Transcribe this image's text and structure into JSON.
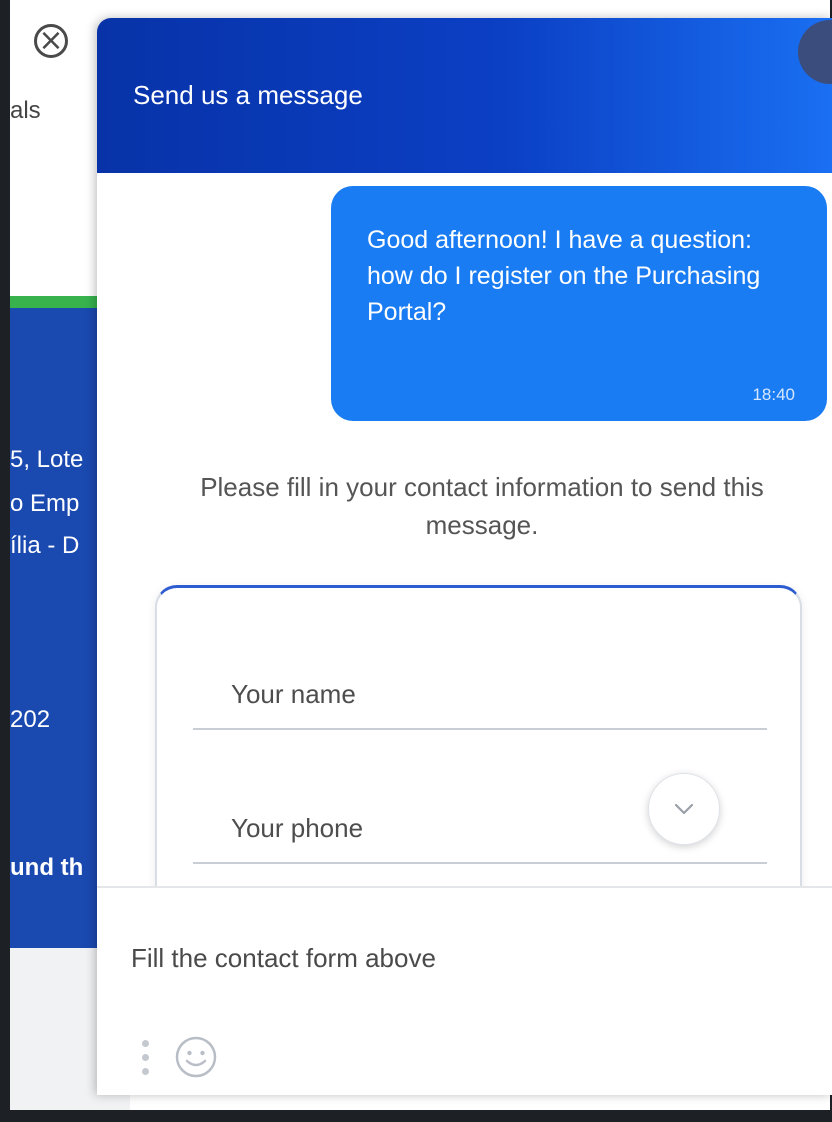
{
  "background_page": {
    "nav_fragment": "als",
    "footer_lines": [
      "5, Lote",
      "o Emp",
      "ília - D",
      "202",
      "und th"
    ]
  },
  "chat": {
    "header_title": "Send us a message",
    "message": {
      "text": "Good afternoon! I have a question: how do I register on the Purchasing Portal?",
      "time": "18:40"
    },
    "contact_prompt": "Please fill in your contact information to send this message.",
    "form": {
      "name_placeholder": "Your name",
      "phone_placeholder": "Your phone"
    },
    "composer": {
      "placeholder": "Fill the contact form above"
    },
    "colors": {
      "header_start": "#0833a8",
      "header_end": "#1a6ff2",
      "bubble": "#1a7cf2"
    }
  },
  "icons": [
    "close-icon",
    "chevron-down-icon",
    "menu-dots-icon",
    "emoji-icon"
  ]
}
